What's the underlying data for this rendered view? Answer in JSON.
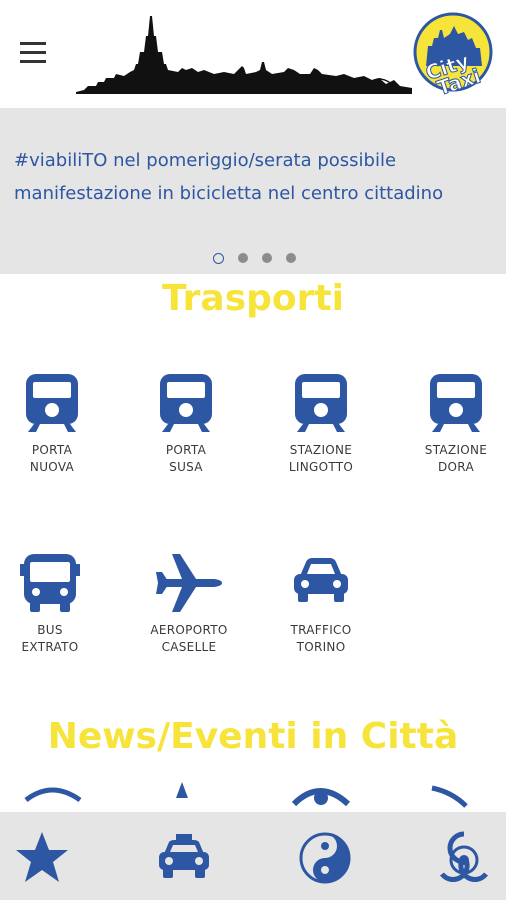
{
  "header": {
    "menu_icon": "hamburger-menu-icon",
    "logo_text": [
      "City",
      "Taxi"
    ]
  },
  "news_banner": {
    "text": "#viabiliTO nel pomeriggio/serata possibile manifestazione in bicicletta nel centro cittadino",
    "dots_total": 4,
    "active_dot": 1
  },
  "transport_section": {
    "title": "Trasporti",
    "items": [
      {
        "label": "PORTA\nNUOVA",
        "icon": "train-icon"
      },
      {
        "label": "PORTA\nSUSA",
        "icon": "train-icon"
      },
      {
        "label": "STAZIONE\nLINGOTTO",
        "icon": "train-icon"
      },
      {
        "label": "STAZIONE\nDORA",
        "icon": "train-icon"
      },
      {
        "label": "BUS\nEXTRATO",
        "icon": "bus-icon"
      },
      {
        "label": "AEROPORTO\nCASELLE",
        "icon": "airplane-icon"
      },
      {
        "label": "TRAFFICO\nTORINO",
        "icon": "car-icon"
      }
    ]
  },
  "news_section": {
    "title": "News/Eventi in Città"
  },
  "bottom_nav": [
    {
      "icon": "star-icon"
    },
    {
      "icon": "taxi-icon"
    },
    {
      "icon": "yin-yang-icon"
    },
    {
      "icon": "biohazard-icon"
    }
  ],
  "colors": {
    "primary_blue": "#2d56a3",
    "accent_yellow": "#f7e43b",
    "banner_gray": "#e5e5e5"
  }
}
